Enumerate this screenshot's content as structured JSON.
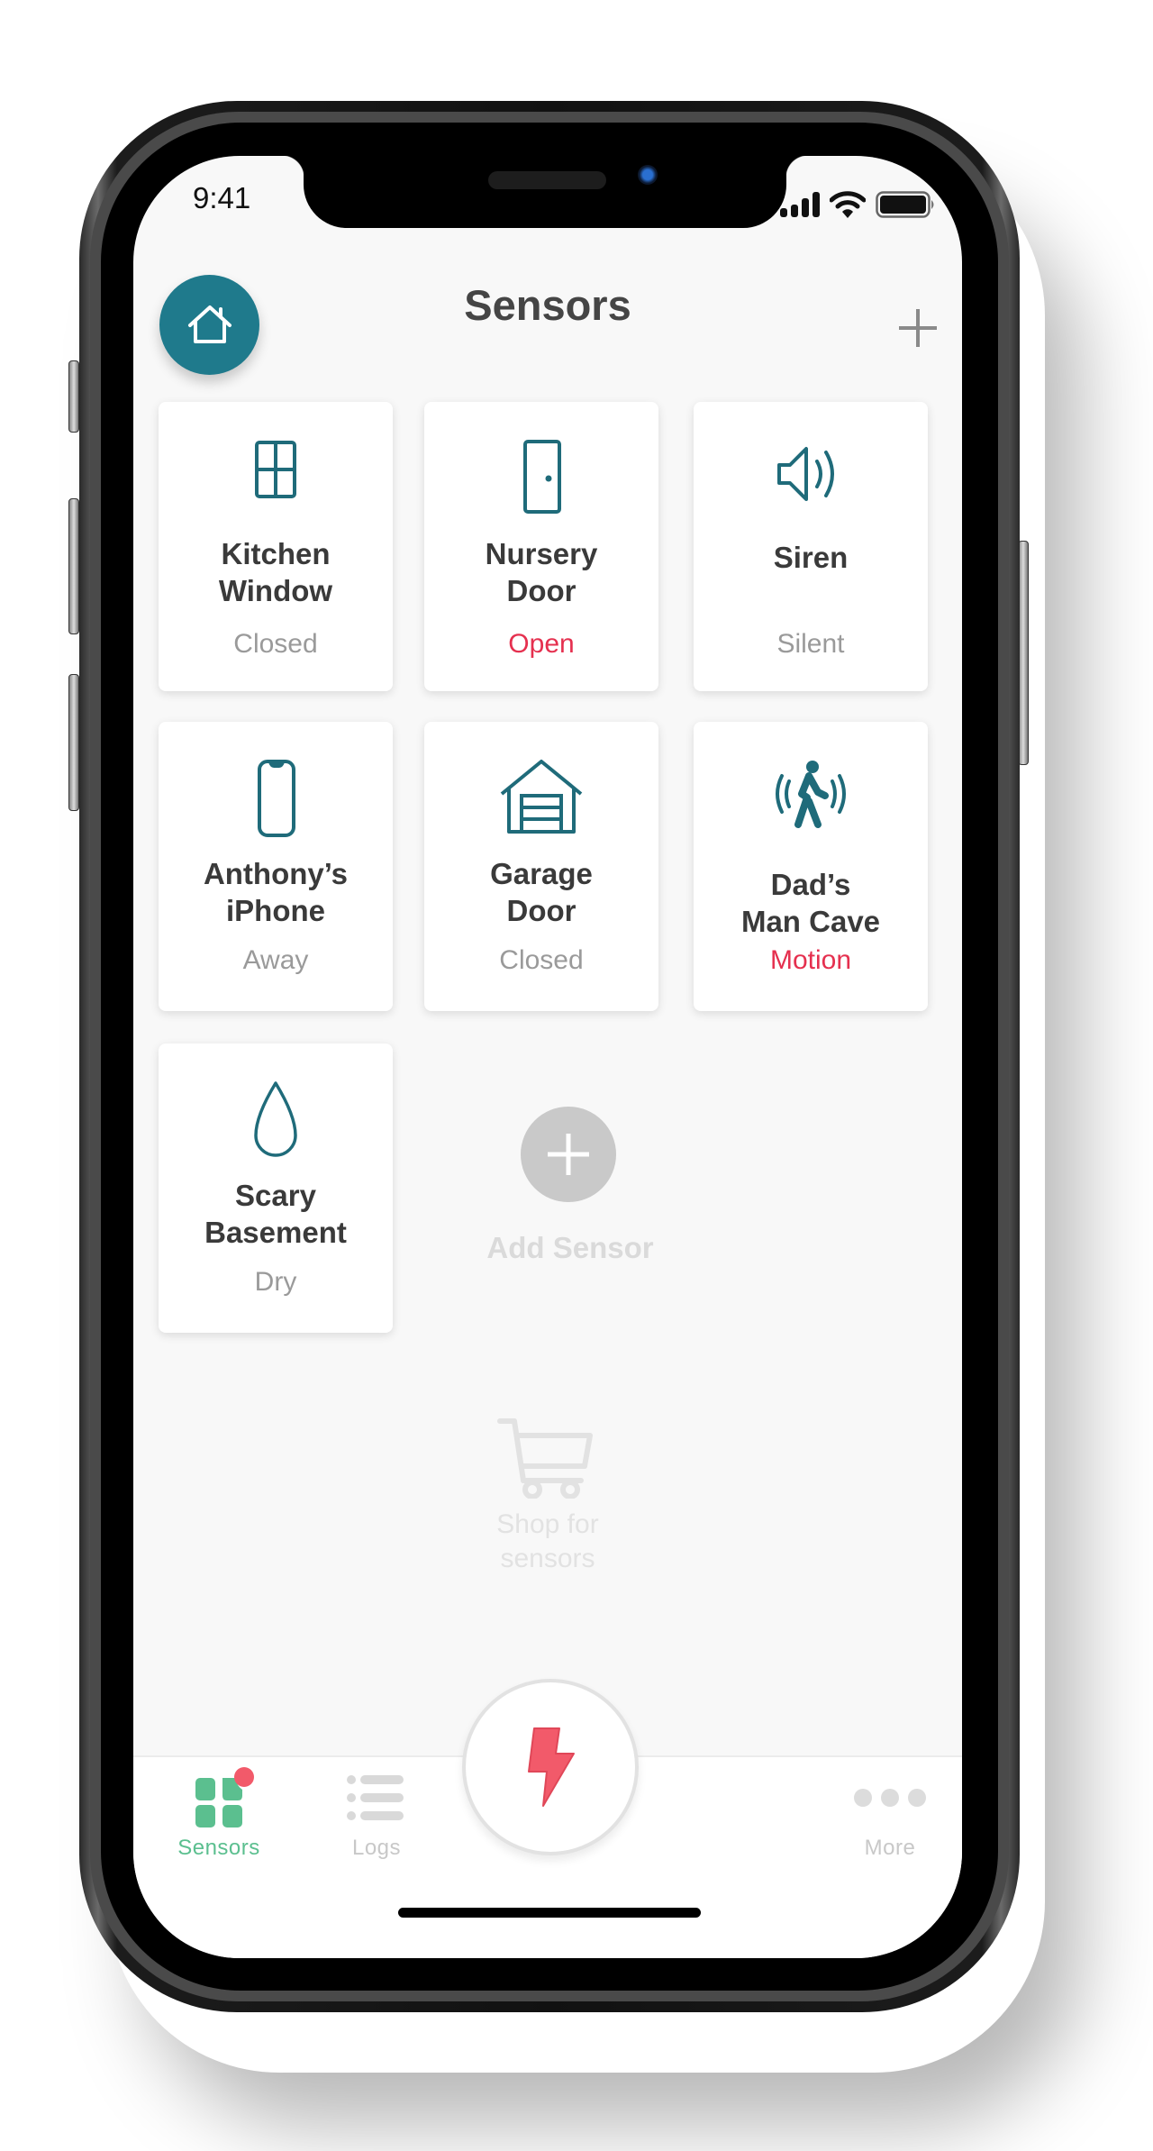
{
  "status_bar": {
    "time": "9:41",
    "icons": [
      "signal-icon",
      "wifi-icon",
      "battery-icon"
    ]
  },
  "header": {
    "title": "Sensors",
    "home_button_icon": "home-icon",
    "add_button_icon": "plus-icon"
  },
  "sensors": [
    {
      "name_line1": "Kitchen",
      "name_line2": "Window",
      "status": "Closed",
      "alert": false,
      "icon": "window-icon"
    },
    {
      "name_line1": "Nursery",
      "name_line2": "Door",
      "status": "Open",
      "alert": true,
      "icon": "door-icon"
    },
    {
      "name_line1": "Siren",
      "name_line2": "",
      "status": "Silent",
      "alert": false,
      "icon": "speaker-icon"
    },
    {
      "name_line1": "Anthony’s",
      "name_line2": "iPhone",
      "status": "Away",
      "alert": false,
      "icon": "phone-icon"
    },
    {
      "name_line1": "Garage",
      "name_line2": "Door",
      "status": "Closed",
      "alert": false,
      "icon": "garage-icon"
    },
    {
      "name_line1": "Dad’s",
      "name_line2": "Man Cave",
      "status": "Motion",
      "alert": true,
      "icon": "motion-icon"
    },
    {
      "name_line1": "Scary",
      "name_line2": "Basement",
      "status": "Dry",
      "alert": false,
      "icon": "water-drop-icon"
    }
  ],
  "add_sensor": {
    "label": "Add Sensor",
    "icon": "plus-circle-icon"
  },
  "shop": {
    "line1": "Shop for",
    "line2": "sensors",
    "icon": "cart-icon"
  },
  "tabbar": {
    "tabs": [
      {
        "label": "Sensors",
        "icon": "sensors-grid-icon",
        "active": true,
        "badge": true
      },
      {
        "label": "Logs",
        "icon": "list-icon",
        "active": false,
        "badge": false
      },
      {
        "label": "More",
        "icon": "more-dots-icon",
        "active": false,
        "badge": false
      }
    ],
    "center_action_icon": "lightning-bolt-icon"
  },
  "colors": {
    "accent_teal": "#1f7a8c",
    "alert_red": "#e5304f",
    "bolt_red": "#f25a6a",
    "active_tab_green": "#5bbf8f",
    "inactive_grey": "#c8c8c8"
  }
}
